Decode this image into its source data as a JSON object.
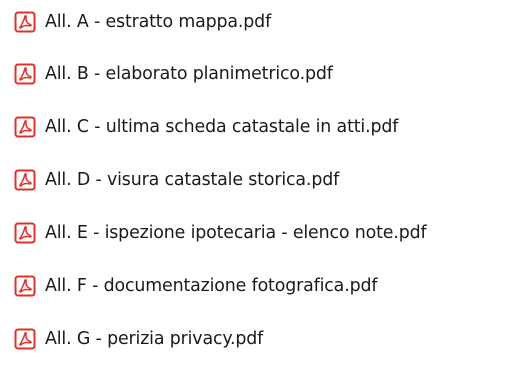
{
  "files": [
    {
      "name": "All. A - estratto mappa.pdf",
      "icon": "pdf-file-icon"
    },
    {
      "name": "All. B - elaborato planimetrico.pdf",
      "icon": "pdf-file-icon"
    },
    {
      "name": "All. C - ultima scheda catastale in atti.pdf",
      "icon": "pdf-file-icon"
    },
    {
      "name": "All. D - visura catastale storica.pdf",
      "icon": "pdf-file-icon"
    },
    {
      "name": "All. E - ispezione ipotecaria - elenco note.pdf",
      "icon": "pdf-file-icon"
    },
    {
      "name": "All. F - documentazione fotografica.pdf",
      "icon": "pdf-file-icon"
    },
    {
      "name": "All. G - perizia privacy.pdf",
      "icon": "pdf-file-icon"
    }
  ],
  "colors": {
    "icon_red": "#e0302c",
    "text": "#1a1a1a"
  }
}
